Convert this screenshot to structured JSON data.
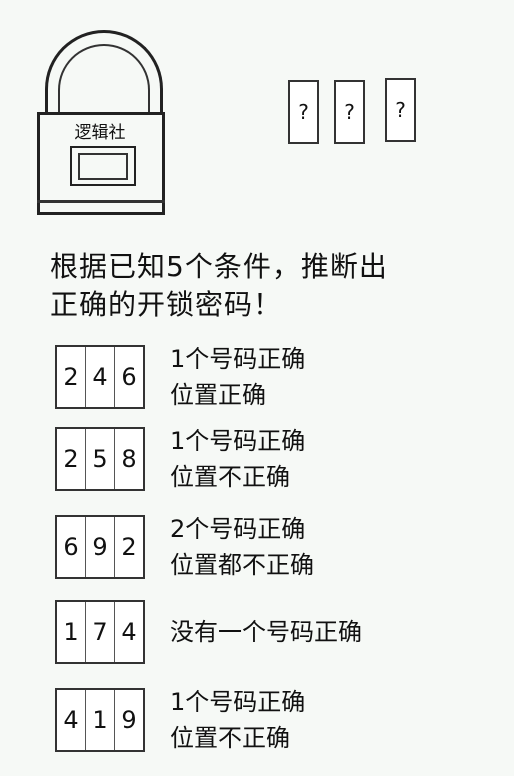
{
  "lock": {
    "label": "逻辑社"
  },
  "unknown_digits": [
    "?",
    "?",
    "?"
  ],
  "instructions": [
    "根据已知5个条件，推断出",
    "正确的开锁密码！"
  ],
  "clues": [
    {
      "digits": [
        "2",
        "4",
        "6"
      ],
      "lines": [
        "1个号码正确",
        "位置正确"
      ]
    },
    {
      "digits": [
        "2",
        "5",
        "8"
      ],
      "lines": [
        "1个号码正确",
        "位置不正确"
      ]
    },
    {
      "digits": [
        "6",
        "9",
        "2"
      ],
      "lines": [
        "2个号码正确",
        "位置都不正确"
      ]
    },
    {
      "digits": [
        "1",
        "7",
        "4"
      ],
      "lines": [
        "没有一个号码正确"
      ]
    },
    {
      "digits": [
        "4",
        "1",
        "9"
      ],
      "lines": [
        "1个号码正确",
        "位置不正确"
      ]
    }
  ]
}
